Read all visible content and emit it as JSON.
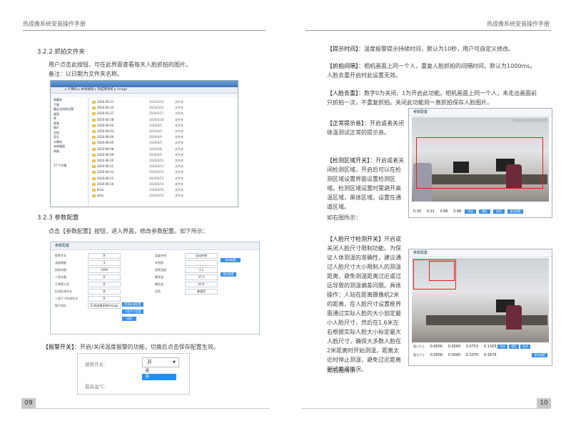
{
  "left": {
    "header": "热成像系统安装操作手册",
    "page_no": "09",
    "s1": {
      "heading": "3.2.2 抓拍文件夹",
      "p1": "用户点击此按钮，可在此界面查看每天人脸抓拍的图片。",
      "p2": "备注：以日期为文件夹名称。"
    },
    "explorer": {
      "address": "▸ 计算机 ▸ 本地磁盘 ▸ 热成像系统 ▸ image",
      "search_placeholder": "搜索 image",
      "tree": [
        "收藏夹",
        "下载",
        "最近访问的位置",
        "桌面",
        "库",
        "视频",
        "图片",
        "文档",
        "音乐",
        "计算机",
        "本地磁盘",
        "网络"
      ],
      "files": [
        {
          "name": "2020-05-21",
          "date": "2020/5/21",
          "type": "文件夹"
        },
        {
          "name": "2020-05-22",
          "date": "2020/5/22",
          "type": "文件夹"
        },
        {
          "name": "2020-05-27",
          "date": "2020/5/27",
          "type": "文件夹"
        },
        {
          "name": "2020-05-28",
          "date": "2020/5/28",
          "type": "文件夹"
        },
        {
          "name": "2020-06-02",
          "date": "2020/6/2",
          "type": "文件夹"
        },
        {
          "name": "2020-06-03",
          "date": "2020/6/3",
          "type": "文件夹"
        },
        {
          "name": "2020-06-04",
          "date": "2020/6/4",
          "type": "文件夹"
        },
        {
          "name": "2020-06-05",
          "date": "2020/6/5",
          "type": "文件夹"
        },
        {
          "name": "2020-06-08",
          "date": "2020/6/8",
          "type": "文件夹"
        },
        {
          "name": "2020-06-09",
          "date": "2020/6/9",
          "type": "文件夹"
        },
        {
          "name": "2020-06-10",
          "date": "2020/6/10",
          "type": "文件夹"
        },
        {
          "name": "2020-06-11",
          "date": "2020/6/11",
          "type": "文件夹"
        },
        {
          "name": "2020-06-12",
          "date": "2020/6/12",
          "type": "文件夹"
        },
        {
          "name": "2020-06-15",
          "date": "2020/6/15",
          "type": "文件夹"
        },
        {
          "name": "2020-06-16",
          "date": "2020/6/16",
          "type": "文件夹"
        },
        {
          "name": "Error",
          "date": "2020/6/16",
          "type": "文件夹"
        },
        {
          "name": "data",
          "date": "2020/6/16",
          "type": "文件夹"
        }
      ],
      "status": "17 个对象"
    },
    "s2": {
      "heading": "3.2.3 参数配置",
      "p1": "点击【参数配置】按钮，进入界面，修改参数配置。如下所示："
    },
    "cfg": {
      "title": "参数配置",
      "rows_left": [
        {
          "label": "报警开关",
          "value": "开"
        },
        {
          "label": "温度精度",
          "value": "3"
        },
        {
          "label": "抓拍间隔",
          "value": "1000"
        },
        {
          "label": "人脸去重",
          "value": "开"
        },
        {
          "label": "正常提示音",
          "value": "开"
        },
        {
          "label": "检测区域开关",
          "value": "关"
        },
        {
          "label": "人脸尺寸检测开关",
          "value": "开"
        },
        {
          "label": "图片保存",
          "value": "E:\\热成像系统\\image"
        }
      ],
      "rows_right": [
        {
          "label": "温度补偿",
          "value": "自动补偿"
        },
        {
          "label": "补偿值",
          "value": ""
        },
        {
          "label": "报警温度",
          "value": "1.1"
        },
        {
          "label": "最高温",
          "value": "37.3"
        },
        {
          "label": "最低温",
          "value": "30.0"
        },
        {
          "label": "语音",
          "value": "普通话"
        }
      ],
      "buttons": [
        "检测区域设置",
        "人脸尺寸设置",
        "浏览",
        "保存配置",
        "保存配置"
      ]
    },
    "alarm": {
      "text_hl": "【报警开关】",
      "text": "：开启/关闭温度报警的功能，切换后点击保存配置生效。",
      "label1": "报警开关:",
      "selected": "开",
      "opt_off": "关",
      "opt_on": "开",
      "label2": "最高温℃:"
    }
  },
  "right": {
    "header": "热成像系统安装操作手册",
    "page_no": "10",
    "items": [
      {
        "hl": "【提示时间】",
        "text": "：温度报警提示持续时间，默认为10秒，用户可自定义修改。"
      },
      {
        "hl": "【抓拍间隔】",
        "text": "：相机画面上同一个人，重复人脸抓拍的间隔时间，默认为1000ms。人脸去重开启时此设置无效。"
      },
      {
        "hl": "【人脸去重】",
        "text": "：数字0为关闭，1为开启此功能。相机画面上同一个人，未走出画面前只抓拍一次，不重复抓拍。关闭此功能则一直抓拍保存人脸图片。"
      },
      {
        "hl": "【正常提示音】",
        "text": "：开启或者关闭体温测试正常的提示音。"
      },
      {
        "hl": "【检测区域开关】",
        "text": "：开启或者关闭检测区域，开启后可以在检测区域设置界面设置检测区域。检测区域设置时需避开高温区域，黑体区域，设置在通道区域。"
      },
      {
        "hl": "",
        "text": "如右图所示："
      },
      {
        "hl": "【人脸尺寸检测开关】",
        "text": "开启或关闭人脸尺寸限制功能。为保证人体测温的准确性，建议通过人脸尺寸大小限制人的测温距离，避免测温距离过近或过远导致的测温偏差问题。具体操作：人站在距离摄像机2米的距离，在人脸尺寸设置框界面通过实际人脸的大小划定最小人脸尺寸，然后在1.6米左右根据实际人脸大小标定最大人脸尺寸，确保大多数人脸在2米距离时开始测温，距离太近时停止测温，避免过近距离测试高温情况。"
      },
      {
        "hl": "",
        "text": "如右图所示："
      }
    ],
    "cam1": {
      "title": "参数配置",
      "timestamp": "2020-12-20  00:57:43",
      "values": [
        "0.35",
        "0.21",
        "0.66",
        "0.68"
      ],
      "buttons": [
        "添加",
        "确定",
        "取消",
        "保存配置"
      ]
    },
    "cam2": {
      "title": "参数配置",
      "row1_label": "最小尺寸",
      "row1": [
        "0.0000",
        "0.0000",
        "0.0753",
        "0.1183"
      ],
      "row2_label": "最大尺寸",
      "row2": [
        "0.0000",
        "0.0000",
        "0.1070",
        "0.1674"
      ],
      "buttons": [
        "添加",
        "确定",
        "取消",
        "保存配置"
      ]
    }
  }
}
